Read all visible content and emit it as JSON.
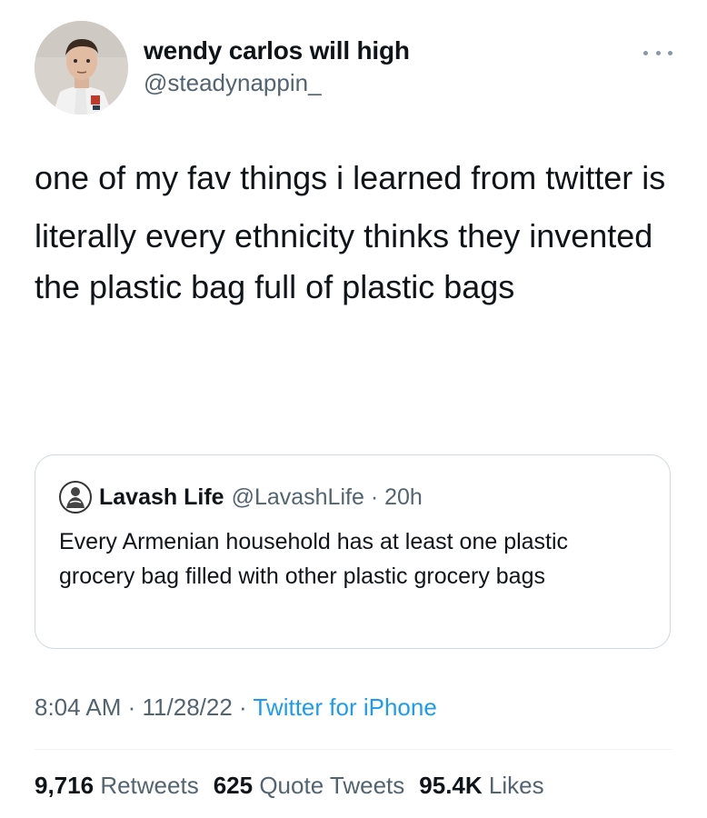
{
  "tweet": {
    "author": {
      "name": "wendy carlos will high",
      "handle": "@steadynappin_",
      "avatar_icon": "profile-photo"
    },
    "more_icon": "more-dots-icon",
    "paragraphs": [
      "one of my fav things i learned from twitter is",
      "literally every ethnicity thinks they invented the plastic bag full of plastic bags"
    ],
    "quote": {
      "name": "Lavash Life",
      "handle": "@LavashLife",
      "time": "20h",
      "text": "Every Armenian household has at least one plastic grocery bag filled with other plastic grocery bags"
    },
    "timestamp": {
      "time": "8:04 AM",
      "date": "11/28/22",
      "source": "Twitter for iPhone"
    },
    "stats": {
      "retweets_count": "9,716",
      "retweets_label": "Retweets",
      "quotes_count": "625",
      "quotes_label": "Quote Tweets",
      "likes_count": "95.4K",
      "likes_label": "Likes"
    }
  },
  "colors": {
    "text": "#0f1419",
    "secondary": "#536471",
    "link": "#1d9bf0",
    "border": "#cfd9de"
  }
}
